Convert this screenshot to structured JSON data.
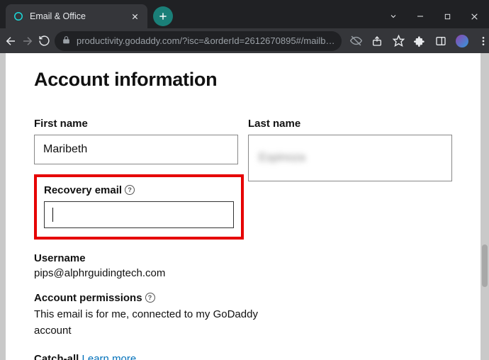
{
  "tab": {
    "title": "Email & Office"
  },
  "url": "productivity.godaddy.com/?isc=&orderId=2612670895#/mailb…",
  "page": {
    "heading": "Account information",
    "firstNameLabel": "First name",
    "firstNameValue": "Maribeth",
    "lastNameLabel": "Last name",
    "lastNameValue": "Espinoza",
    "recoveryLabel": "Recovery email",
    "recoveryValue": "",
    "usernameLabel": "Username",
    "usernameValue": "pips@alphrguidingtech.com",
    "permsLabel": "Account permissions",
    "permsDesc": "This email is for me, connected to my GoDaddy account",
    "catchallLabel": "Catch-all",
    "catchallLink": "Learn more"
  }
}
